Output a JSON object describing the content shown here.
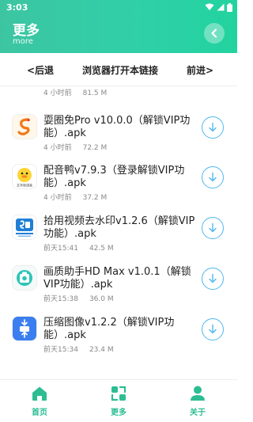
{
  "status": {
    "time": "3:03"
  },
  "header": {
    "title": "更多",
    "subtitle": "more"
  },
  "nav": {
    "back": "<后退",
    "open_browser": "浏览器打开本链接",
    "forward": "前进>"
  },
  "partial_item": {
    "time": "4 小时前",
    "size": "81.5 M"
  },
  "items": [
    {
      "name": "耍圈免Pro v10.0.0（解锁VIP功能）.apk",
      "time": "4 小时前",
      "size": "72.2 M",
      "icon": "shuaquan-app-icon"
    },
    {
      "name": "配音鸭v7.9.3（登录解锁VIP功能）.apk",
      "time": "4 小时前",
      "size": "37.2 M",
      "icon": "peiyinya-app-icon",
      "icon_caption": "文字转语音"
    },
    {
      "name": "拾用视频去水印v1.2.6（解锁VIP功能）.apk",
      "time": "前天15:41",
      "size": "42.5 M",
      "icon": "shiyong-watermark-app-icon"
    },
    {
      "name": "画质助手HD Max v1.0.1（解锁VIP功能）.apk",
      "time": "前天15:38",
      "size": "36.0 M",
      "icon": "huazhi-app-icon"
    },
    {
      "name": "压缩图像v1.2.2（解锁VIP功能）.apk",
      "time": "前天15:34",
      "size": "23.4 M",
      "icon": "compress-image-app-icon"
    }
  ],
  "tabs": [
    {
      "label": "首页",
      "icon": "home-icon"
    },
    {
      "label": "更多",
      "icon": "more-apps-icon"
    },
    {
      "label": "关于",
      "icon": "user-icon"
    }
  ],
  "colors": {
    "accent": "#2dbd92",
    "header_start": "#3dc5a2",
    "header_end": "#22d39f",
    "download": "#4fb8f0"
  }
}
